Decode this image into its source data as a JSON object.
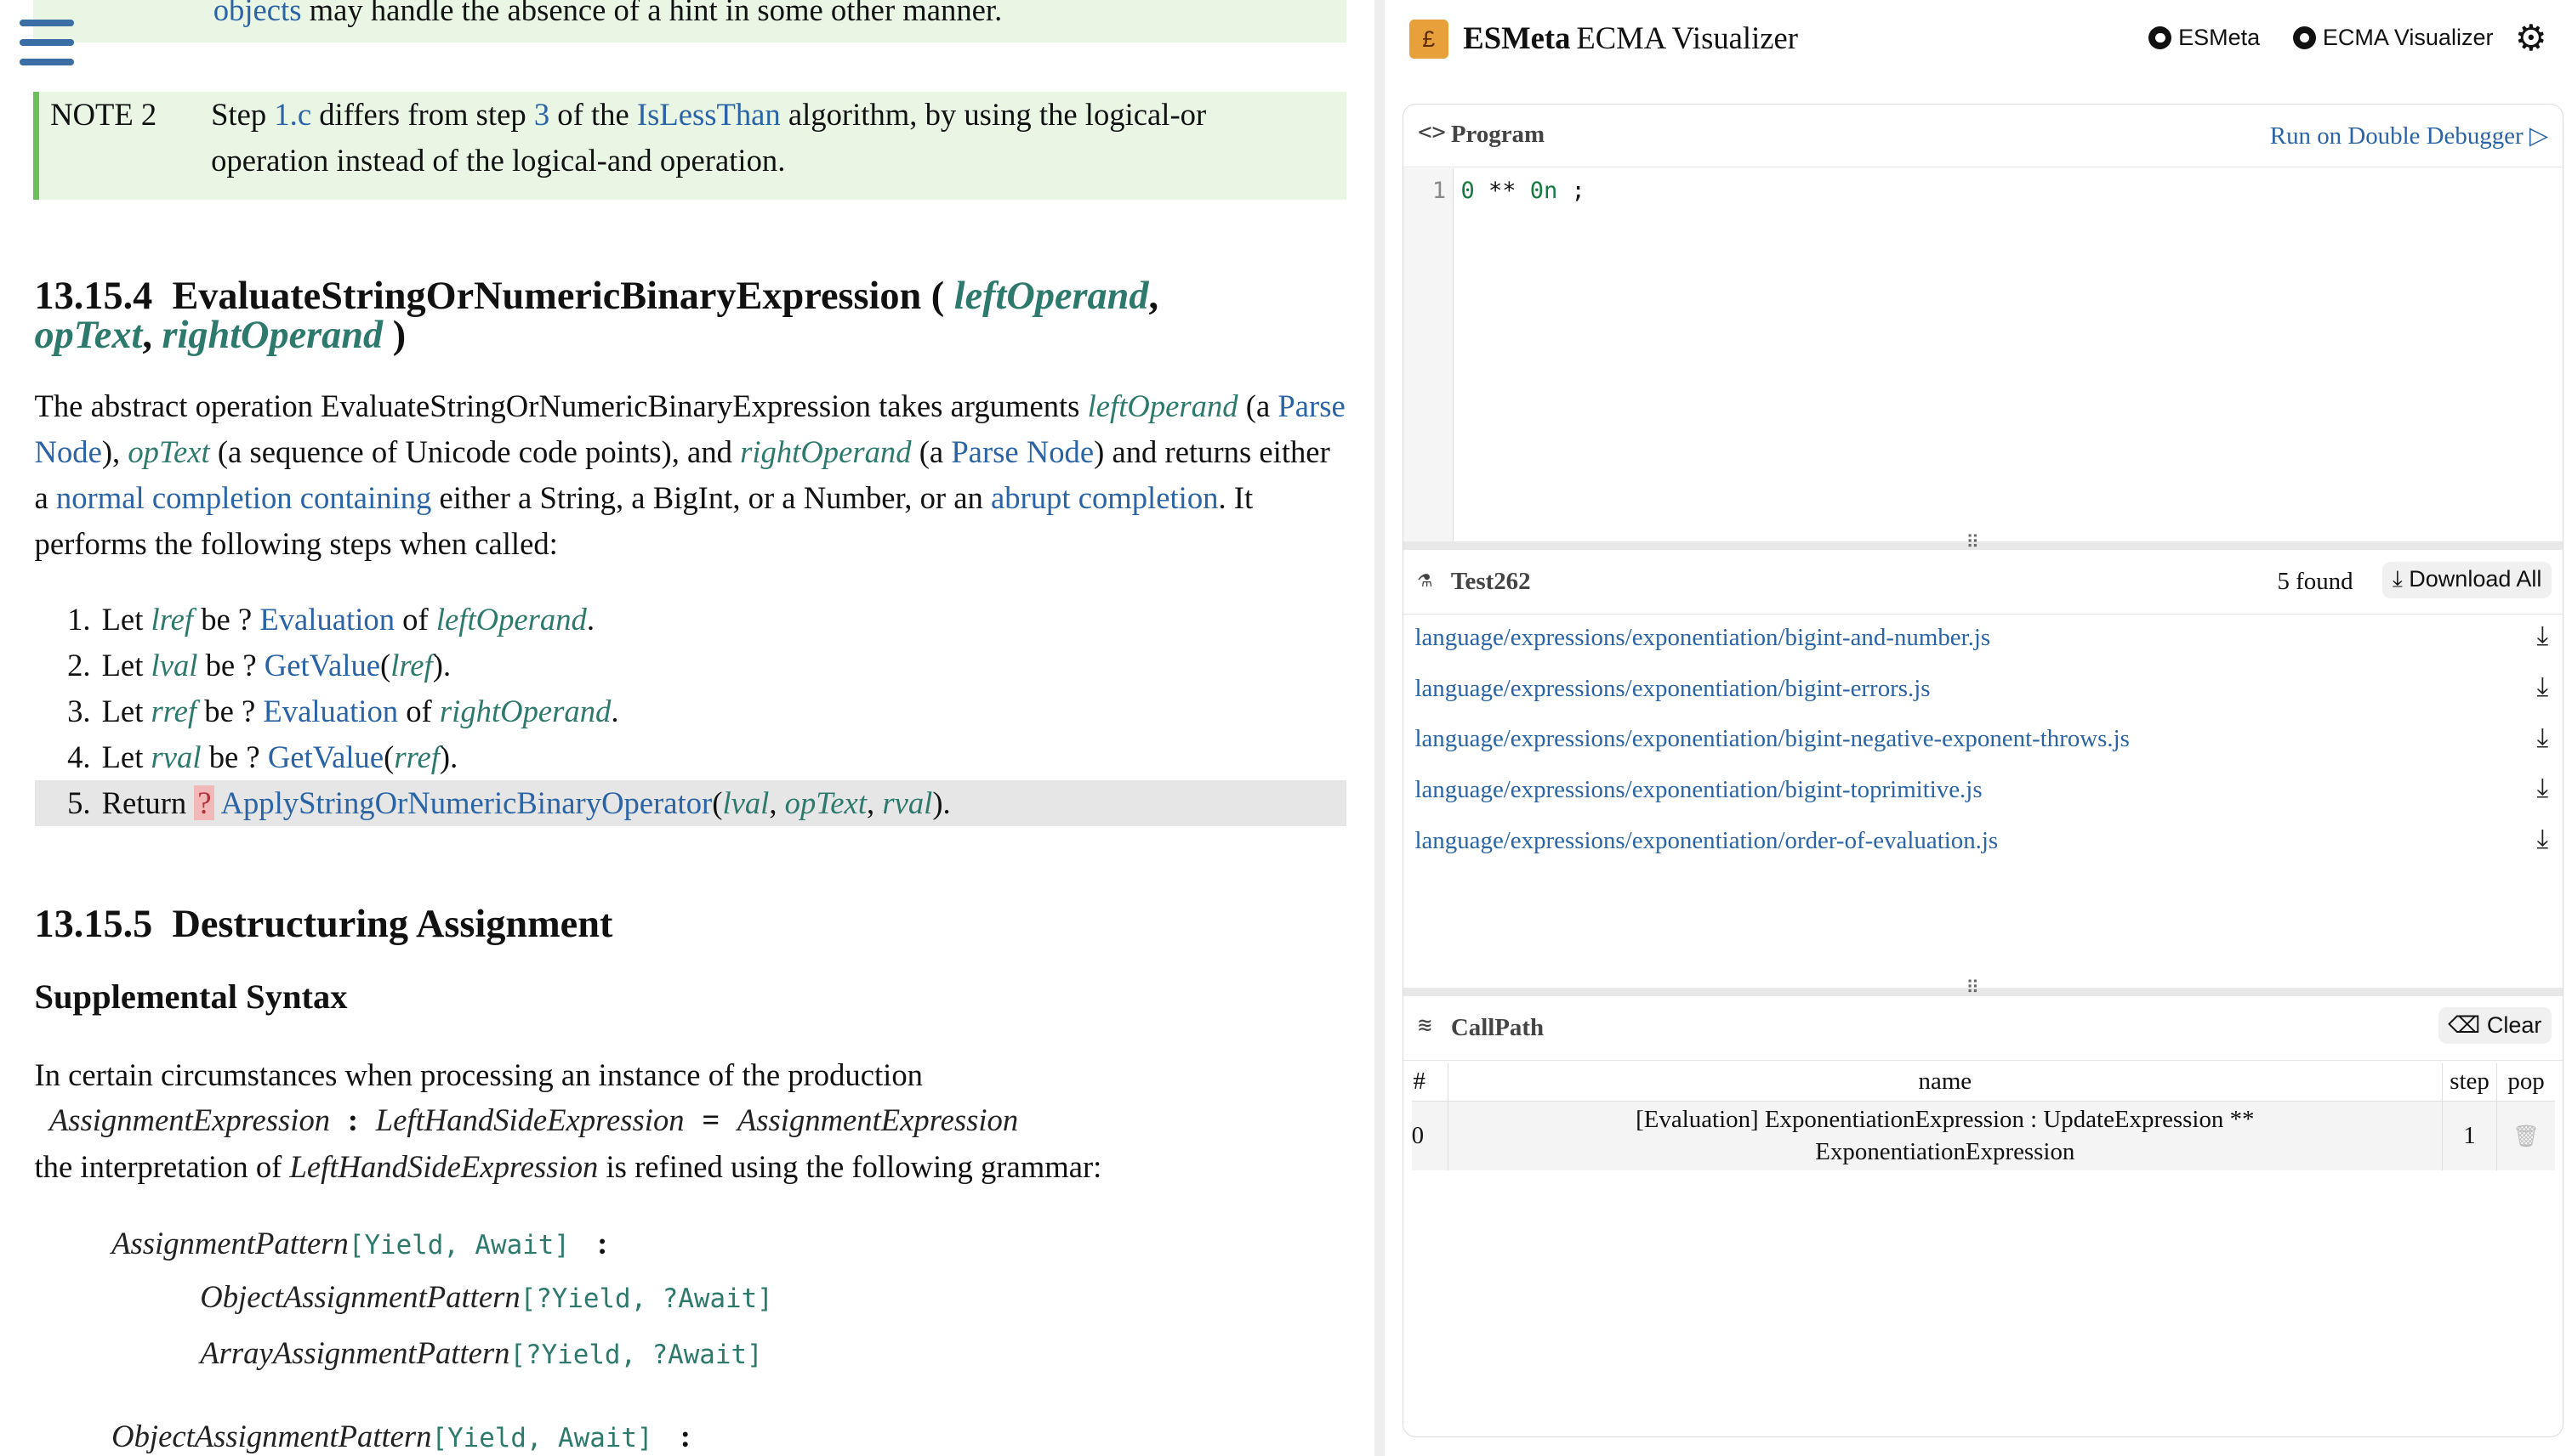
{
  "spec": {
    "note1_tail_link": "objects",
    "note1_tail_text": " may handle the absence of a hint in some other manner.",
    "note2": {
      "label": "NOTE 2",
      "p1": "Step ",
      "link_step": "1.c",
      "p2": " differs from step ",
      "link_3": "3",
      "p3": " of the ",
      "link_islessthan": "IsLessThan",
      "p4": " algorithm, by using the logical-or operation instead of the logical-and operation."
    },
    "sec_13_15_4": {
      "number": "13.15.4",
      "name": "EvaluateStringOrNumericBinaryExpression (",
      "param1": "leftOperand",
      "comma1": ",",
      "param2": "opText",
      "comma2": ",",
      "param3": "rightOperand",
      "close": ")",
      "desc": {
        "t1": "The abstract operation EvaluateStringOrNumericBinaryExpression takes arguments ",
        "v1": "leftOperand",
        "t2": " (a ",
        "l1": "Parse Node",
        "t3": "), ",
        "v2": "opText",
        "t4": " (a sequence of Unicode code points), and ",
        "v3": "rightOperand",
        "t5": " (a ",
        "l2": "Parse Node",
        "t6": ") and returns either a ",
        "l3": "normal completion containing",
        "t7": " either a String, a BigInt, or a Number, or an ",
        "l4": "abrupt completion",
        "t8": ". It performs the following steps when called:"
      },
      "steps": [
        {
          "num": "1.",
          "a": "Let ",
          "v": "lref",
          "b": " be ? ",
          "l": "Evaluation",
          "c": " of ",
          "v2": "leftOperand",
          "d": "."
        },
        {
          "num": "2.",
          "a": "Let ",
          "v": "lval",
          "b": " be ? ",
          "l": "GetValue",
          "c": "(",
          "v2": "lref",
          "d": ")."
        },
        {
          "num": "3.",
          "a": "Let ",
          "v": "rref",
          "b": " be ? ",
          "l": "Evaluation",
          "c": " of ",
          "v2": "rightOperand",
          "d": "."
        },
        {
          "num": "4.",
          "a": "Let ",
          "v": "rval",
          "b": " be ? ",
          "l": "GetValue",
          "c": "(",
          "v2": "rref",
          "d": ")."
        }
      ],
      "step5": {
        "num": "5.",
        "a": "Return ",
        "q": "?",
        "l": "ApplyStringOrNumericBinaryOperator",
        "b": "(",
        "v1": "lval",
        "c1": ", ",
        "v2": "opText",
        "c2": ", ",
        "v3": "rval",
        "d": ")."
      }
    },
    "sec_13_15_5": {
      "number": "13.15.5",
      "name": "Destructuring Assignment",
      "subtitle": "Supplemental Syntax",
      "p1": "In certain circumstances when processing an instance of the production",
      "prod_lhs": "AssignmentExpression",
      "prod_colon": ":",
      "prod_mid": "LeftHandSideExpression",
      "prod_eq": "=",
      "prod_rhs": "AssignmentExpression",
      "p2a": "the interpretation of ",
      "p2b": "LeftHandSideExpression",
      "p2c": " is refined using the following grammar:",
      "g1_nt": "AssignmentPattern",
      "g1_prm": "[Yield, Await]",
      "g1_colon": ":",
      "g2_nt": "ObjectAssignmentPattern",
      "g2_prm": "[?Yield, ?Await]",
      "g3_nt": "ArrayAssignmentPattern",
      "g3_prm": "[?Yield, ?Await]",
      "g4_nt": "ObjectAssignmentPattern",
      "g4_prm": "[Yield, Await]",
      "g4_colon": ":"
    }
  },
  "viz": {
    "logo_glyph": "£",
    "brand": "ESMeta",
    "brand_sub": "ECMA Visualizer",
    "link_esmeta": "ESMeta",
    "link_visualizer": "ECMA Visualizer",
    "gear_icon": "⚙",
    "program": {
      "title": "Program",
      "icon": "<>",
      "run_link": "Run on Double Debugger ▷",
      "line_no": "1",
      "code_a": "0",
      "code_op": " ** ",
      "code_b": "0n",
      "code_end": " ;"
    },
    "test262": {
      "title": "Test262",
      "icon": "⚗",
      "found": "5 found",
      "download_all": "Download All",
      "tests": [
        "language/expressions/exponentiation/bigint-and-number.js",
        "language/expressions/exponentiation/bigint-errors.js",
        "language/expressions/exponentiation/bigint-negative-exponent-throws.js",
        "language/expressions/exponentiation/bigint-toprimitive.js",
        "language/expressions/exponentiation/order-of-evaluation.js"
      ],
      "download_icon": "⤓"
    },
    "callpath": {
      "title": "CallPath",
      "icon": "≋",
      "clear": "Clear",
      "headers": {
        "idx": "#",
        "name": "name",
        "step": "step",
        "pop": "pop"
      },
      "rows": [
        {
          "idx": "0",
          "name": "[Evaluation] ExponentiationExpression : UpdateExpression ** ExponentiationExpression",
          "step": "1",
          "pop_icon": "🗑"
        }
      ]
    }
  },
  "colors": {
    "link": "#2a64a6",
    "var": "#2d7a6c",
    "note_bg": "#e9f6e4",
    "note_bar": "#6cc05a",
    "logo": "#e8a13a"
  }
}
